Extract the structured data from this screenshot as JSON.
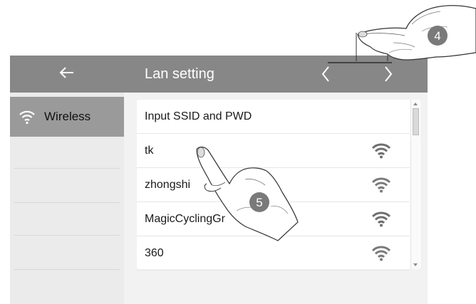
{
  "header": {
    "back_icon": "arrow-left-icon",
    "title": "Lan setting",
    "prev_icon": "chevron-left-icon",
    "next_icon": "chevron-right-icon"
  },
  "sidebar": {
    "items": [
      {
        "label": "Wireless",
        "icon": "wifi-icon",
        "active": true
      }
    ]
  },
  "list": {
    "rows": [
      {
        "label": "Input SSID and PWD"
      },
      {
        "label": "tk",
        "icon": "wifi-signal-icon"
      },
      {
        "label": "zhongshi",
        "icon": "wifi-signal-icon"
      },
      {
        "label": "MagicCyclingGr",
        "icon": "wifi-signal-icon"
      },
      {
        "label": "360",
        "icon": "wifi-signal-icon"
      }
    ]
  },
  "callouts": [
    {
      "step": "4"
    },
    {
      "step": "5"
    }
  ],
  "colors": {
    "header_bg": "#878787",
    "active_item_bg": "#9a9a9a",
    "screen_bg": "#f2f2f2",
    "callout_badge": "#7a7a7a"
  }
}
